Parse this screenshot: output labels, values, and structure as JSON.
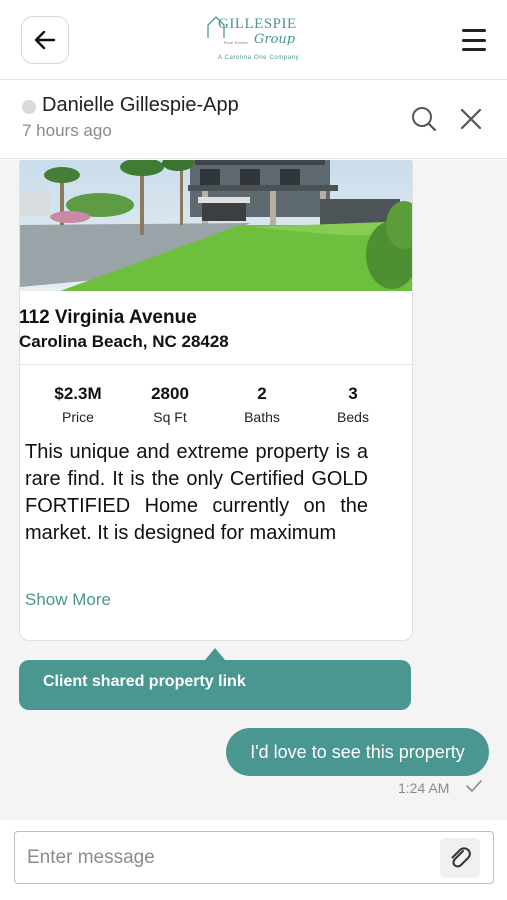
{
  "header": {
    "logo": {
      "brand": "GILLESPIE",
      "script": "Group",
      "tagline": "Real Estate",
      "company": "A Carolina One Company"
    }
  },
  "conversation": {
    "contact_name": "Danielle Gillespie-App",
    "last_seen": "7 hours ago"
  },
  "property": {
    "address_line1": "112 Virginia Avenue",
    "address_line2": "Carolina Beach, NC 28428",
    "stats": [
      {
        "value": "$2.3M",
        "label": "Price"
      },
      {
        "value": "2800",
        "label": "Sq Ft"
      },
      {
        "value": "2",
        "label": "Baths"
      },
      {
        "value": "3",
        "label": "Beds"
      }
    ],
    "description": "This unique and extreme property is a rare find. It is the only Certified GOLD FORTIFIED Home currently on the market. It is designed for maximum",
    "show_more": "Show More"
  },
  "messages": {
    "shared_notice": "Client shared property link",
    "outgoing_text": "I'd love to see this property",
    "outgoing_time": "1:24 AM"
  },
  "composer": {
    "placeholder": "Enter message"
  },
  "icons": {
    "back": "arrow-left-icon",
    "menu": "hamburger-menu-icon",
    "search": "search-icon",
    "close": "close-icon",
    "read": "checkmark-icon",
    "attach": "paperclip-icon"
  },
  "colors": {
    "accent": "#4a9690",
    "background": "#f4f4f4",
    "muted_text": "#8a8a8a"
  }
}
